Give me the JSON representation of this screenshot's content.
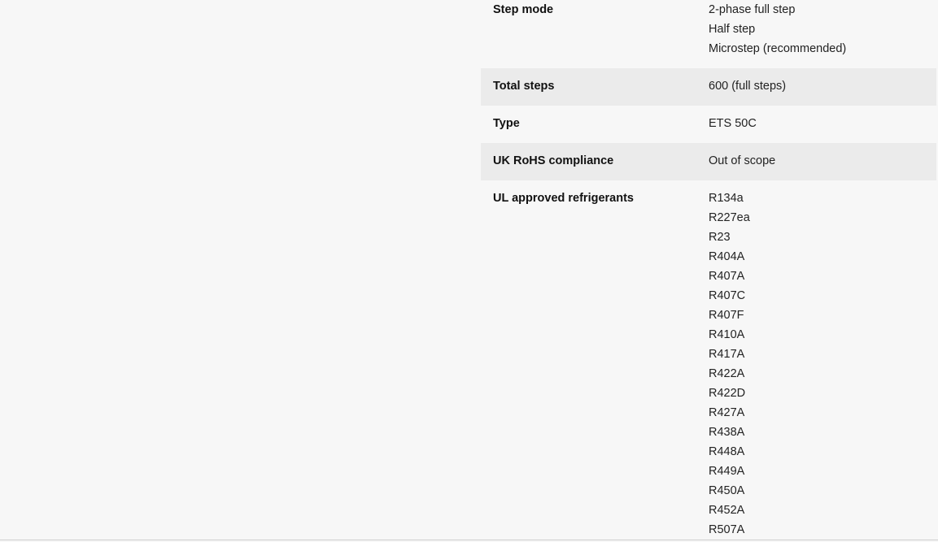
{
  "specs": [
    {
      "label": "Step mode",
      "values": [
        "2-phase full step",
        "Half step",
        "Microstep (recommended)"
      ],
      "shaded": false
    },
    {
      "label": "Total steps",
      "values": [
        "600 (full steps)"
      ],
      "shaded": true
    },
    {
      "label": "Type",
      "values": [
        "ETS 50C"
      ],
      "shaded": false
    },
    {
      "label": "UK RoHS compliance",
      "values": [
        "Out of scope"
      ],
      "shaded": true
    },
    {
      "label": "UL approved refrigerants",
      "values": [
        "R134a",
        "R227ea",
        "R23",
        "R404A",
        "R407A",
        "R407C",
        "R407F",
        "R410A",
        "R417A",
        "R422A",
        "R422D",
        "R427A",
        "R438A",
        "R448A",
        "R449A",
        "R450A",
        "R452A",
        "R507A"
      ],
      "shaded": false
    }
  ]
}
